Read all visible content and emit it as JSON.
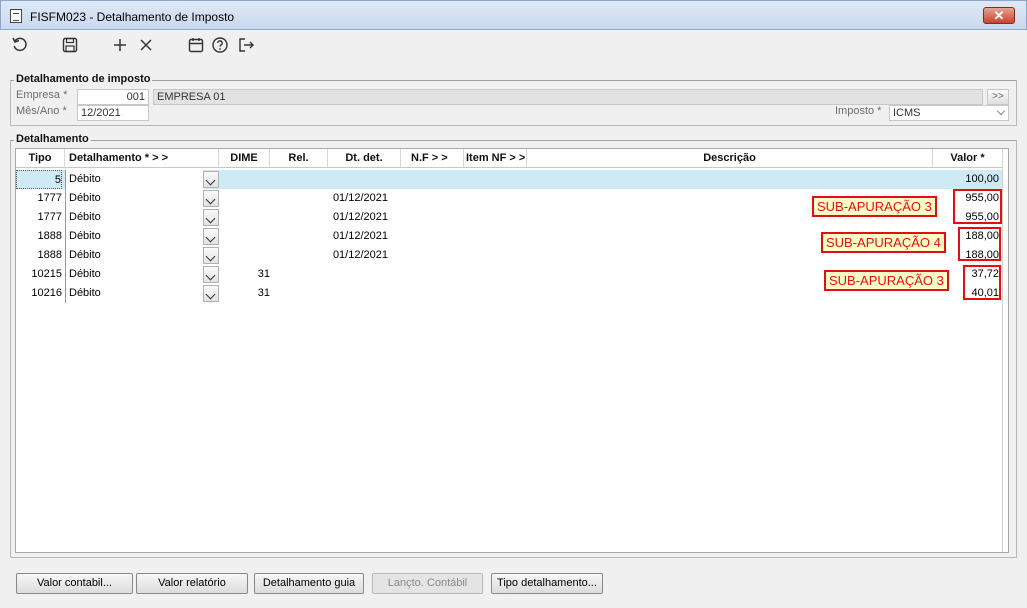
{
  "window": {
    "title": "FISFM023 - Detalhamento de Imposto",
    "close_label": "✕"
  },
  "toolbar": {
    "icons": [
      "refresh-icon",
      "save-icon",
      "add-icon",
      "delete-icon",
      "calendar-icon",
      "help-icon",
      "exit-icon"
    ]
  },
  "header_group": {
    "legend": "Detalhamento de imposto",
    "empresa_label": "Empresa *",
    "empresa_code": "001",
    "empresa_name": "EMPRESA 01",
    "mesano_label": "Mês/Ano *",
    "mesano_value": "12/2021",
    "imposto_label": "Imposto *",
    "imposto_value": "ICMS"
  },
  "detail_group": {
    "legend": "Detalhamento",
    "columns": [
      "Tipo",
      "Detalhamento *  > >",
      "DIME",
      "Rel.",
      "Dt. det.",
      "N.F  > >",
      "Item NF > >",
      "Descrição",
      "Valor *"
    ],
    "rows": [
      {
        "tipo": "5",
        "detalhamento": "Débito",
        "dime": "",
        "rel": "",
        "dt": "",
        "nf": "",
        "item": "",
        "desc": "",
        "valor": "100,00"
      },
      {
        "tipo": "1777",
        "detalhamento": "Débito",
        "dime": "",
        "rel": "",
        "dt": "01/12/2021",
        "nf": "",
        "item": "",
        "desc": "",
        "valor": "955,00"
      },
      {
        "tipo": "1777",
        "detalhamento": "Débito",
        "dime": "",
        "rel": "",
        "dt": "01/12/2021",
        "nf": "",
        "item": "",
        "desc": "",
        "valor": "955,00"
      },
      {
        "tipo": "1888",
        "detalhamento": "Débito",
        "dime": "",
        "rel": "",
        "dt": "01/12/2021",
        "nf": "",
        "item": "",
        "desc": "",
        "valor": "188,00"
      },
      {
        "tipo": "1888",
        "detalhamento": "Débito",
        "dime": "",
        "rel": "",
        "dt": "01/12/2021",
        "nf": "",
        "item": "",
        "desc": "",
        "valor": "188,00"
      },
      {
        "tipo": "10215",
        "detalhamento": "Débito",
        "dime": "31",
        "rel": "",
        "dt": "",
        "nf": "",
        "item": "",
        "desc": "",
        "valor": "37,72"
      },
      {
        "tipo": "10216",
        "detalhamento": "Débito",
        "dime": "31",
        "rel": "",
        "dt": "",
        "nf": "",
        "item": "",
        "desc": "",
        "valor": "40,01"
      }
    ]
  },
  "annotations": [
    "SUB-APURAÇÃO 3",
    "SUB-APURAÇÃO 4",
    "SUB-APURAÇÃO 3"
  ],
  "buttons": {
    "valor_contabil": "Valor contabil...",
    "valor_relatorio": "Valor relatório",
    "detalhamento_guia": "Detalhamento guia",
    "lancto_contabil": "Lançto. Contábil",
    "tipo_detalhamento": "Tipo detalhamento..."
  }
}
